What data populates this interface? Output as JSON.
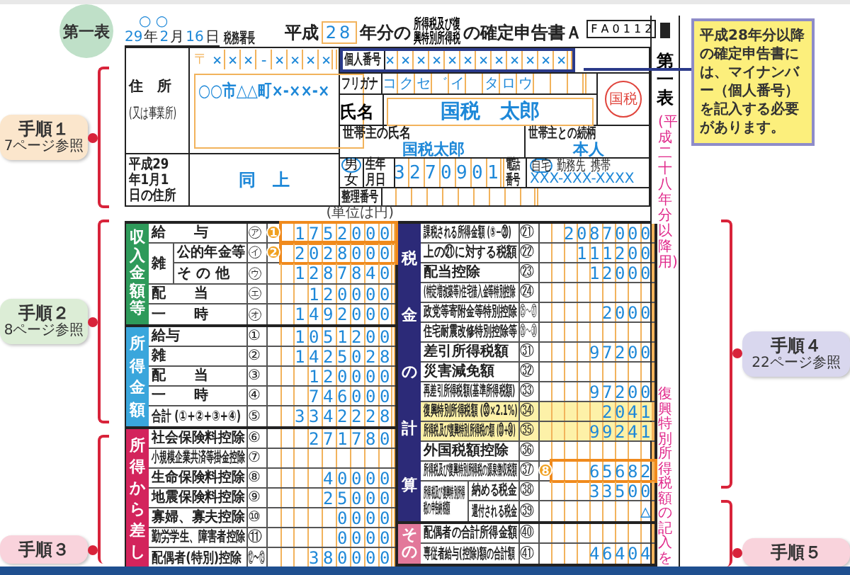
{
  "corner_badge": "第一表",
  "left_steps": [
    {
      "title": "手順１",
      "ref": "7ページ参照",
      "color": "#fbe6cc"
    },
    {
      "title": "手順２",
      "ref": "8ページ参照",
      "color": "#dcedd6"
    },
    {
      "title": "手順３",
      "color": "#f9d3dc"
    }
  ],
  "right_steps": [
    {
      "title": "手順４",
      "ref": "22ページ参照",
      "color": "#d9d7ee"
    },
    {
      "title": "手順５",
      "color": "#f9d3dc"
    }
  ],
  "form": {
    "date": {
      "marks": "○ ○",
      "year": "29",
      "year_unit": "年",
      "month": "2",
      "month_unit": "月",
      "day": "16",
      "day_unit": "日",
      "office": "税務署長"
    },
    "title": {
      "era": "平成",
      "year": "28",
      "before": "年分の",
      "small": "所得税及び復興特別所得税",
      "after": "の確定申告書Ａ"
    },
    "code": "F A 0 1 1 2",
    "postal": {
      "mark": "〒",
      "value": "×××-××××"
    },
    "address": {
      "label": "住　所",
      "sublabel": "(又は事業所)",
      "value": "○○市△△町×-××-×"
    },
    "jan1_address": {
      "label": "平成29年1月1日の住所",
      "value": "同　上"
    },
    "my_number": {
      "label": "個人番号",
      "value": "××××××××××××"
    },
    "furigana": {
      "label": "フリガナ",
      "value": "コクセ゛イ　タロウ"
    },
    "name": {
      "label": "氏名",
      "value": "国税　太郎",
      "seal": "国税"
    },
    "householder": {
      "label": "世帯主の氏名",
      "value": "国税太郎"
    },
    "relation": {
      "label": "世帯主との続柄",
      "value": "本人"
    },
    "sex": {
      "options": [
        {
          "label": "男",
          "selected": true
        },
        {
          "label": "女",
          "selected": false
        }
      ]
    },
    "birth": {
      "label": "生年月日",
      "value": "3270901"
    },
    "phone": {
      "label": "電話番号",
      "options": [
        {
          "label": "自宅",
          "selected": true
        },
        {
          "label": "勤務先",
          "selected": false
        },
        {
          "label": "携帯",
          "selected": false
        }
      ],
      "value": "XXX-XXX-XXXX"
    },
    "reference": {
      "label": "整理番号"
    },
    "unit": "(単位は円)",
    "left_groups": [
      {
        "title": "収入金額等",
        "color": "#2e9a5a",
        "rows": [
          {
            "kind": "single",
            "label": "給　　与",
            "num": "㋐",
            "value": "1752000",
            "marker": "1"
          },
          {
            "kind": "split",
            "label": "雑",
            "parts": [
              {
                "label": "公的年金等",
                "num": "㋑",
                "value": "2028000",
                "marker": "2"
              },
              {
                "label": "そ の 他",
                "num": "㋒",
                "value": "1287840"
              }
            ]
          },
          {
            "kind": "single",
            "label": "配　　当",
            "num": "㋓",
            "value": "120000"
          },
          {
            "kind": "single",
            "label": "一　　時",
            "num": "㋔",
            "value": "1492000"
          }
        ]
      },
      {
        "title": "所得金額",
        "color": "#3aa6dc",
        "rows": [
          {
            "kind": "single",
            "label": "給与",
            "num": "①",
            "value": "1051200"
          },
          {
            "kind": "single",
            "label": "雑",
            "num": "②",
            "value": "1425028"
          },
          {
            "kind": "single",
            "label": "配　　当",
            "num": "③",
            "value": "120000"
          },
          {
            "kind": "single",
            "label": "一　　時",
            "num": "④",
            "value": "746000"
          },
          {
            "kind": "single",
            "label": "合計 (①+②+③+④)",
            "num": "⑤",
            "value": "3342228"
          }
        ]
      },
      {
        "title": "所得から差し",
        "color": "#d3245c",
        "rows": [
          {
            "kind": "single",
            "label": "社会保険料控除",
            "num": "⑥",
            "value": "271780"
          },
          {
            "kind": "single",
            "label": "小規模企業共済等掛金控除",
            "num": "⑦"
          },
          {
            "kind": "single",
            "label": "生命保険料控除",
            "num": "⑧",
            "value": "40000"
          },
          {
            "kind": "single",
            "label": "地震保険料控除",
            "num": "⑨",
            "value": "25000"
          },
          {
            "kind": "single",
            "label": "寡婦、寡夫控除",
            "num": "⑩",
            "value": "0000"
          },
          {
            "kind": "single",
            "label": "勤労学生、障害者控除",
            "num": "⑪",
            "value": "0000"
          },
          {
            "kind": "single",
            "label": "配偶者(特別)控除",
            "num": "⑫〜⑬",
            "value": "380000"
          }
        ]
      }
    ],
    "right_groups": [
      {
        "title": "税金の計算",
        "color": "#2c2a78",
        "rows": [
          {
            "kind": "single",
            "label": "課税される所得金額 (⑤−⑳)",
            "num": "㉑",
            "value": "2087000",
            "highlight": false
          },
          {
            "kind": "single",
            "label": "上の㉑に対する税額",
            "num": "㉒",
            "value": "111200",
            "highlight": false
          },
          {
            "kind": "single",
            "label": "配当控除",
            "num": "㉓",
            "value": "12000",
            "highlight": false
          },
          {
            "kind": "single",
            "label": "(特定増改築等)住宅借入金等特別控除",
            "num": "㉔",
            "highlight": false
          },
          {
            "kind": "single",
            "label": "政党等寄附金等特別控除",
            "num": "㉕〜㉗",
            "value": "2000",
            "highlight": false
          },
          {
            "kind": "single",
            "label": "住宅耐震改修特別控除等",
            "num": "㉘〜㉚",
            "highlight": false
          },
          {
            "kind": "single",
            "label": "差引所得税額",
            "num": "㉛",
            "value": "97200",
            "highlight": false
          },
          {
            "kind": "single",
            "label": "災害減免額",
            "num": "㉜",
            "highlight": false
          },
          {
            "kind": "single",
            "label": "再差引所得税額(基準所得税額)",
            "num": "㉝",
            "value": "97200",
            "highlight": false
          },
          {
            "kind": "single",
            "label": "復興特別所得税額 (㉝×2.1%)",
            "num": "㉞",
            "value": "2041",
            "highlight": true
          },
          {
            "kind": "single",
            "label": "所得税及び復興特別所得税の額 (㉝+㉞)",
            "num": "㉟",
            "value": "99241",
            "highlight": true
          },
          {
            "kind": "single",
            "label": "外国税額控除",
            "num": "㊱",
            "highlight": false
          },
          {
            "kind": "single",
            "label": "所得税及び復興特別所得税の源泉徴収税額",
            "num": "㊲",
            "value": "65682",
            "marker": "8",
            "highlight": false
          },
          {
            "kind": "split",
            "label": "所得税及び復興特別所得税の申告納税額",
            "parts": [
              {
                "label": "納める税金",
                "num": "㊳",
                "value": "33500",
                "highlight": false
              },
              {
                "label": "還付される税金",
                "num": "㊴",
                "prefix": "△",
                "highlight": false
              }
            ]
          }
        ]
      },
      {
        "title": "その",
        "color": "#e2789a",
        "rows": [
          {
            "kind": "single",
            "label": "配偶者の合計所得金額",
            "num": "㊵",
            "highlight": false
          },
          {
            "kind": "single",
            "label": "専従者給与(控除)額の合計額",
            "num": "㊶",
            "value": "46404",
            "highlight": false
          }
        ]
      }
    ]
  },
  "strip": {
    "title": "第一表",
    "period": "(平成二十八年分以降用)",
    "note": "復興特別所得税額の記入を"
  },
  "callout": "平成28年分以降の確定申告書には、マイナンバー（個人番号）を記入する必要があります。"
}
